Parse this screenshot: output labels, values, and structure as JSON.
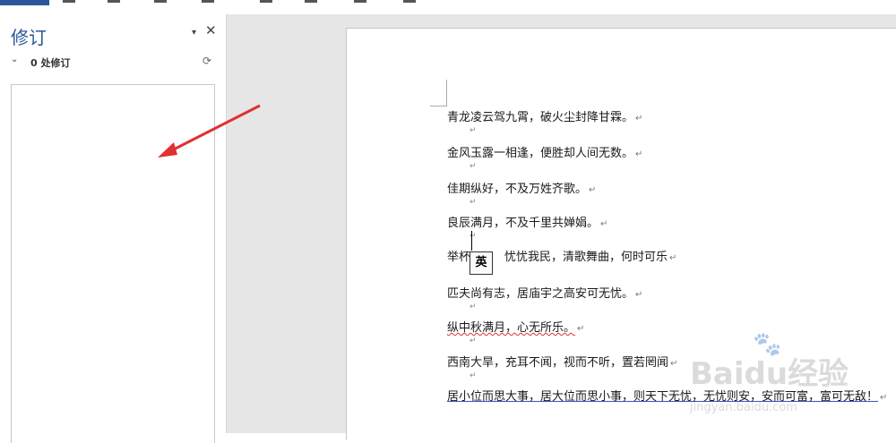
{
  "revisions_pane": {
    "title": "修订",
    "menu_icon": "▾",
    "close_icon": "✕",
    "toggle_icon": "⌄",
    "count_label": "0 处修订",
    "refresh_icon": "⟳"
  },
  "document": {
    "lines": [
      "青龙凌云驾九霄，破火尘封降甘霖。",
      "金风玉露一相逢，便胜却人间无数。",
      "佳期纵好，不及万姓齐歌。",
      "良辰满月，不及千里共婵娟。",
      "举杯",
      "忧忧我民，清歌舞曲，何时可乐",
      "匹夫尚有志，居庙宇之高安可无忧。",
      "纵中秋满月，心无所乐。",
      "西南大旱，充耳不闻，视而不听，置若罔闻",
      "居小位而思大事，居大位而思小事，则天下无忧，无忧则安，安而可富，富可无敌！"
    ],
    "paragraph_mark": "↵",
    "ime_indicator": "英"
  },
  "watermark": {
    "logo": "Bai",
    "logo_mid": "du",
    "logo_cn": "经验",
    "url": "jingyan.baidu.com"
  },
  "colors": {
    "accent": "#2b579a",
    "arrow": "#e03030"
  }
}
